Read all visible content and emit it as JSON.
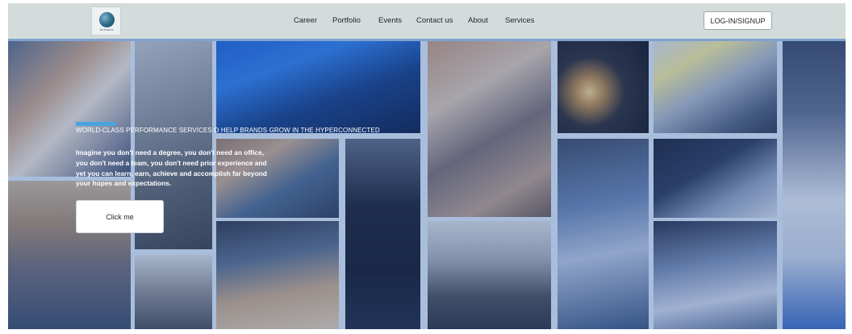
{
  "header": {
    "logo_text": "BUSINESS"
  },
  "nav": {
    "items": [
      {
        "label": "Career"
      },
      {
        "label": "Portfolio"
      },
      {
        "label": "Events"
      },
      {
        "label": "Contact us"
      },
      {
        "label": "About"
      },
      {
        "label": "Services"
      }
    ],
    "login_label": "LOG-IN/SIGNUP"
  },
  "hero": {
    "tagline": "WORLD-CLASS PERFORMANCE SERVICES O HELP BRANDS GROW IN THE HYPERCONNECTED",
    "paragraph": "Imagine you don't need a degree, you don't need an office, you don't need a team, you don't need prior experience and yet you can learn, earn, achieve and accomplish far beyond your hopes and expectations.",
    "cta_label": "Click me"
  },
  "colors": {
    "header_bg": "#d3dcda",
    "overlay_blue": "#a9bedc",
    "accent": "#4aa3df"
  }
}
